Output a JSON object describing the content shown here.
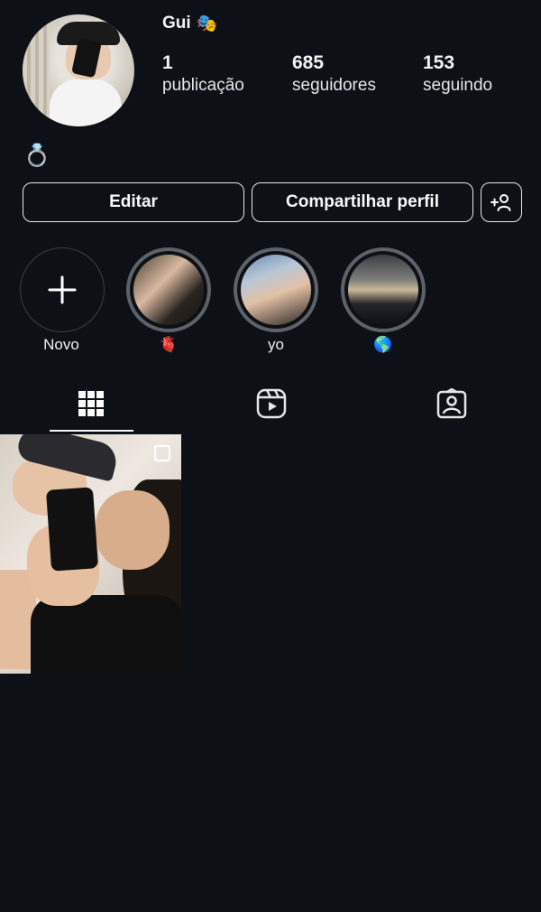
{
  "profile": {
    "username": "Gui",
    "username_emoji": "🎭",
    "bio_emoji": "💍",
    "stats": [
      {
        "value": "1",
        "label": "publicação"
      },
      {
        "value": "685",
        "label": "seguidores"
      },
      {
        "value": "153",
        "label": "seguindo"
      }
    ]
  },
  "buttons": {
    "edit": "Editar",
    "share": "Compartilhar perfil",
    "add_person_icon": "add-person-icon"
  },
  "highlights": [
    {
      "label": "Novo",
      "icon": "plus-icon"
    },
    {
      "label": "🫀"
    },
    {
      "label": "yo"
    },
    {
      "label": "🌎"
    }
  ],
  "tabs": [
    {
      "icon": "grid-icon",
      "active": true
    },
    {
      "icon": "reels-icon",
      "active": false
    },
    {
      "icon": "tagged-icon",
      "active": false
    }
  ],
  "colors": {
    "background": "#0d1117",
    "text": "#f2f2f2",
    "ring": "#5d6168"
  }
}
